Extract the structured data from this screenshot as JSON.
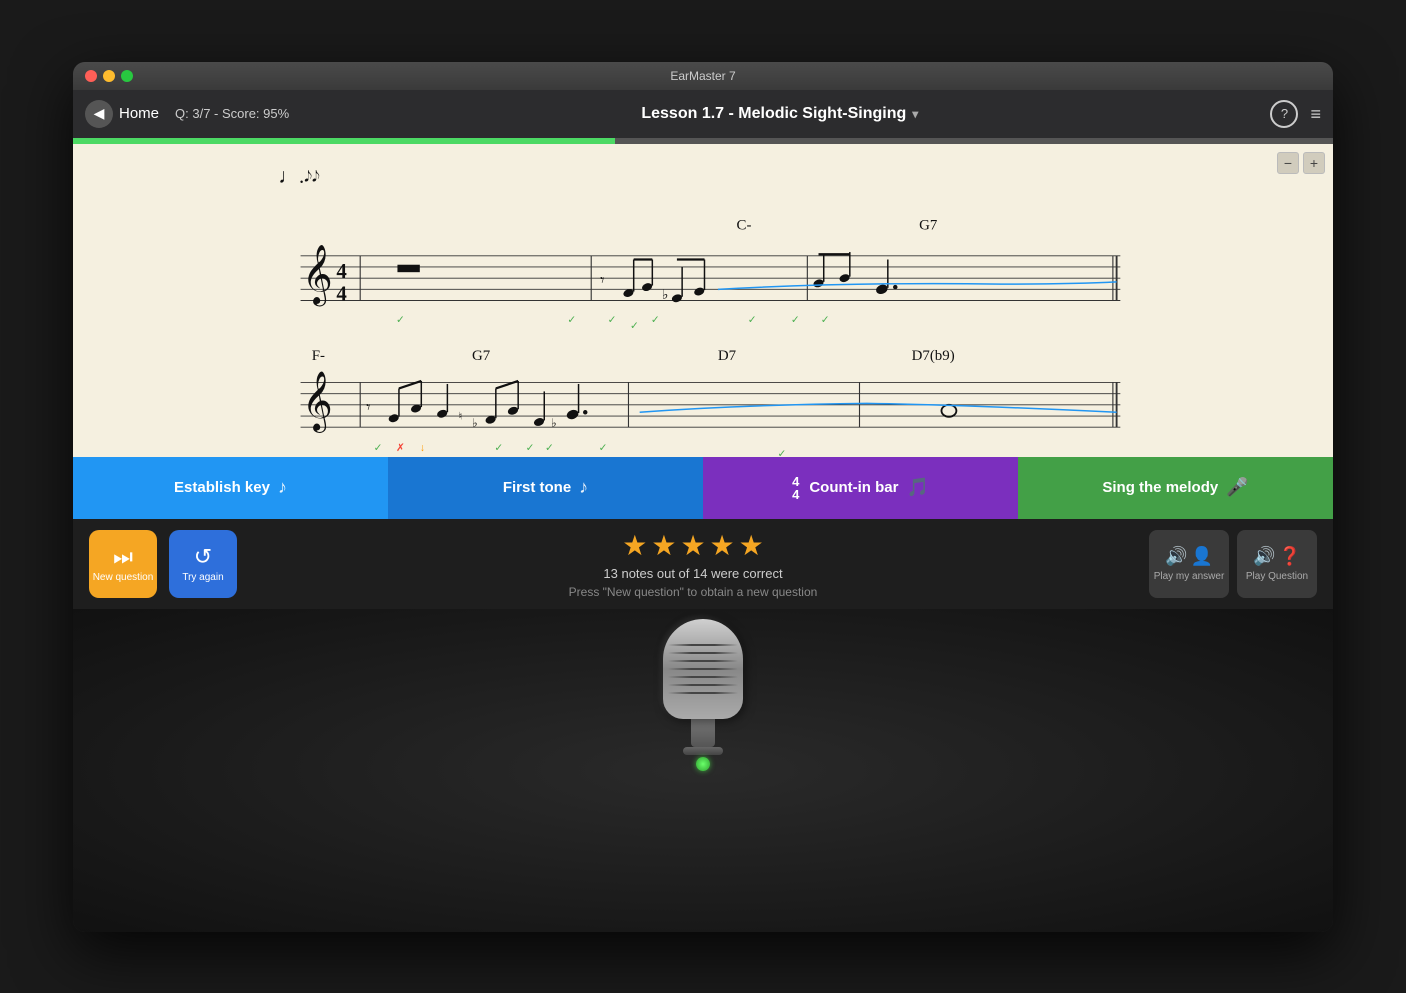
{
  "window": {
    "title": "EarMaster 7"
  },
  "titlebar": {
    "title": "EarMaster 7"
  },
  "topbar": {
    "back_label": "Home",
    "score_label": "Q: 3/7 - Score: 95%",
    "lesson_title": "Lesson 1.7 - Melodic Sight-Singing",
    "help_icon": "?",
    "menu_icon": "≡"
  },
  "progress": {
    "percent": 43
  },
  "action_buttons": {
    "establish_key": "Establish key",
    "first_tone": "First tone",
    "count_in": "Count-in bar",
    "count_in_meter_top": "4",
    "count_in_meter_bottom": "4",
    "sing": "Sing the melody"
  },
  "result": {
    "stars": 5,
    "result_text": "13 notes out of 14 were correct",
    "result_subtext": "Press \"New question\" to obtain a new question",
    "new_question_label": "New question",
    "try_again_label": "Try again",
    "play_my_answer_label": "Play my answer",
    "play_question_label": "Play Question"
  },
  "chord_labels": {
    "line1_c": "C-",
    "line1_g": "G7",
    "line2_f": "F-",
    "line2_g": "G7",
    "line2_d7": "D7",
    "line2_d7b9": "D7(b9)"
  }
}
